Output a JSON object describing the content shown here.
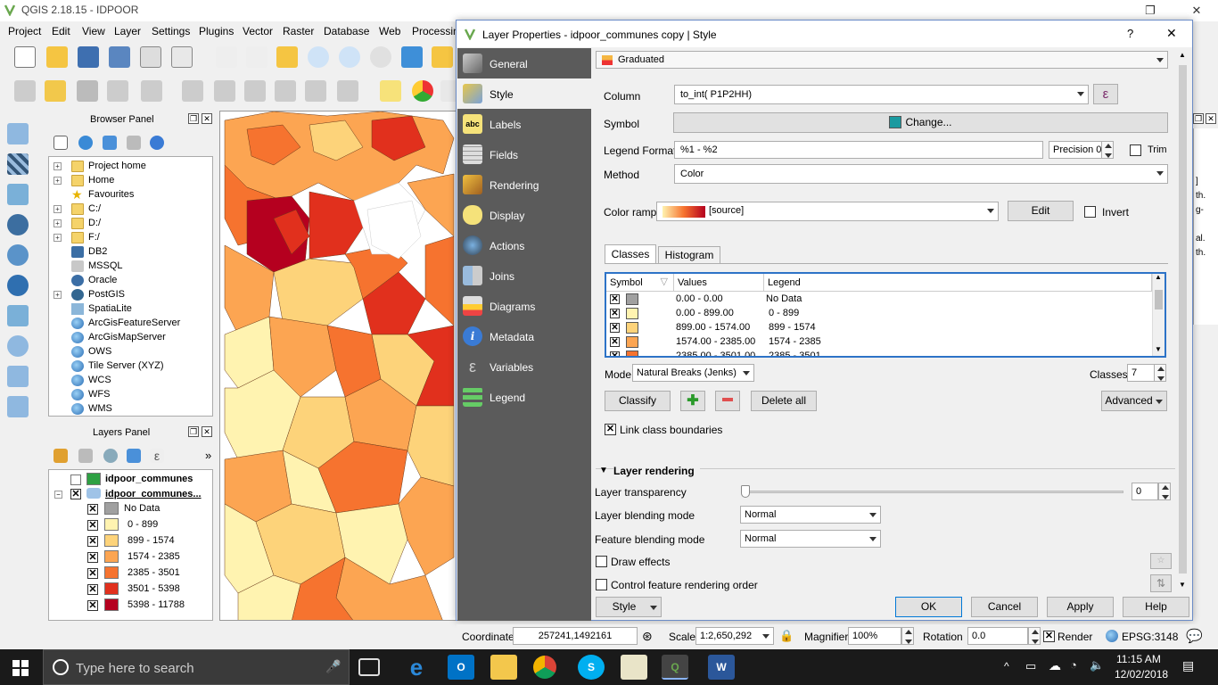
{
  "app": {
    "title": "QGIS 2.18.15 - IDPOOR"
  },
  "menu": [
    "Project",
    "Edit",
    "View",
    "Layer",
    "Settings",
    "Plugins",
    "Vector",
    "Raster",
    "Database",
    "Web",
    "Processing"
  ],
  "browser_panel": {
    "title": "Browser Panel",
    "items": [
      {
        "label": "Project home",
        "icon": "folder-icon",
        "expandable": true
      },
      {
        "label": "Home",
        "icon": "folder-icon",
        "expandable": true
      },
      {
        "label": "Favourites",
        "icon": "star-icon",
        "expandable": false
      },
      {
        "label": "C:/",
        "icon": "folder-icon",
        "expandable": true
      },
      {
        "label": "D:/",
        "icon": "folder-icon",
        "expandable": true
      },
      {
        "label": "F:/",
        "icon": "folder-icon",
        "expandable": true
      },
      {
        "label": "DB2",
        "icon": "db2-icon",
        "expandable": false
      },
      {
        "label": "MSSQL",
        "icon": "database-icon",
        "expandable": false
      },
      {
        "label": "Oracle",
        "icon": "database-icon",
        "expandable": false
      },
      {
        "label": "PostGIS",
        "icon": "elephant-icon",
        "expandable": true
      },
      {
        "label": "SpatiaLite",
        "icon": "feather-icon",
        "expandable": false
      },
      {
        "label": "ArcGisFeatureServer",
        "icon": "globe-icon",
        "expandable": false
      },
      {
        "label": "ArcGisMapServer",
        "icon": "globe-icon",
        "expandable": false
      },
      {
        "label": "OWS",
        "icon": "globe-icon",
        "expandable": false
      },
      {
        "label": "Tile Server (XYZ)",
        "icon": "globe-icon",
        "expandable": false
      },
      {
        "label": "WCS",
        "icon": "globe-icon",
        "expandable": false
      },
      {
        "label": "WFS",
        "icon": "globe-icon",
        "expandable": false
      },
      {
        "label": "WMS",
        "icon": "globe-icon",
        "expandable": false
      }
    ]
  },
  "layers_panel": {
    "title": "Layers Panel",
    "layers": [
      {
        "name": "idpoor_communes",
        "checked": false,
        "color": "#2ea043"
      },
      {
        "name": "idpoor_communes...",
        "checked": true
      }
    ],
    "legend": [
      {
        "label": "No Data",
        "color": "#a0a0a0"
      },
      {
        "label": "0 - 899",
        "color": "#fff3b0"
      },
      {
        "label": "899 - 1574",
        "color": "#fdd37a"
      },
      {
        "label": "1574 - 2385",
        "color": "#fca552"
      },
      {
        "label": "2385 - 3501",
        "color": "#f6732f"
      },
      {
        "label": "3501 - 5398",
        "color": "#e1301d"
      },
      {
        "label": "5398 - 11788",
        "color": "#b5001f"
      }
    ]
  },
  "dialog": {
    "title": "Layer Properties - idpoor_communes copy | Style",
    "help": "?",
    "close": "✕",
    "sidebar": [
      {
        "label": "General",
        "icon": "tools-icon"
      },
      {
        "label": "Style",
        "icon": "paintbrush-icon",
        "active": true
      },
      {
        "label": "Labels",
        "icon": "abc-icon"
      },
      {
        "label": "Fields",
        "icon": "table-icon"
      },
      {
        "label": "Rendering",
        "icon": "brush-icon"
      },
      {
        "label": "Display",
        "icon": "speech-bubble-icon"
      },
      {
        "label": "Actions",
        "icon": "gear-play-icon"
      },
      {
        "label": "Joins",
        "icon": "join-icon"
      },
      {
        "label": "Diagrams",
        "icon": "diagram-icon"
      },
      {
        "label": "Metadata",
        "icon": "info-icon"
      },
      {
        "label": "Variables",
        "icon": "epsilon-icon"
      },
      {
        "label": "Legend",
        "icon": "legend-icon"
      }
    ],
    "renderer": "Graduated",
    "column_label": "Column",
    "column_value": "to_int( P1P2HH)",
    "symbol_label": "Symbol",
    "symbol_button": "Change...",
    "symbol_color": "#1a9aa0",
    "legend_format_label": "Legend Format",
    "legend_format_value": "%1 - %2",
    "precision_label": "Precision 0",
    "trim_label": "Trim",
    "method_label": "Method",
    "method_value": "Color",
    "color_ramp_label": "Color ramp",
    "color_ramp_value": "[source]",
    "edit_button": "Edit",
    "invert_label": "Invert",
    "tabs": [
      "Classes",
      "Histogram"
    ],
    "table_headers": [
      "Symbol",
      "Values",
      "Legend"
    ],
    "classes": [
      {
        "values": "0.00 - 0.00",
        "legend": "No Data",
        "color": "#a0a0a0"
      },
      {
        "values": "0.00 - 899.00",
        "legend": "0 - 899",
        "color": "#fff3b0"
      },
      {
        "values": "899.00 - 1574.00",
        "legend": "899 - 1574",
        "color": "#fdd37a"
      },
      {
        "values": "1574.00 - 2385.00",
        "legend": "1574 - 2385",
        "color": "#fca552"
      },
      {
        "values": "2385.00 - 3501.00",
        "legend": "2385 - 3501",
        "color": "#f6732f"
      }
    ],
    "mode_label": "Mode",
    "mode_value": "Natural Breaks (Jenks)",
    "classes_label": "Classes",
    "classes_count": "7",
    "classify_button": "Classify",
    "delete_all_button": "Delete all",
    "advanced_button": "Advanced",
    "link_boundaries_label": "Link class boundaries",
    "layer_rendering_title": "Layer rendering",
    "transparency_label": "Layer transparency",
    "transparency_value": "0",
    "layer_blending_label": "Layer blending mode",
    "layer_blending_value": "Normal",
    "feature_blending_label": "Feature blending mode",
    "feature_blending_value": "Normal",
    "draw_effects_label": "Draw effects",
    "control_order_label": "Control feature rendering order",
    "style_button": "Style",
    "ok_button": "OK",
    "cancel_button": "Cancel",
    "apply_button": "Apply",
    "help_button": "Help"
  },
  "statusbar": {
    "coordinate_label": "Coordinate",
    "coordinate_value": "257241,1492161",
    "scale_label": "Scale",
    "scale_value": "1:2,650,292",
    "magnifier_label": "Magnifier",
    "magnifier_value": "100%",
    "rotation_label": "Rotation",
    "rotation_value": "0.0",
    "render_label": "Render",
    "epsg": "EPSG:3148"
  },
  "right_edge_text": [
    "]",
    "th.",
    "g-",
    "al.",
    "th."
  ],
  "taskbar": {
    "search_placeholder": "Type here to search",
    "time": "11:15 AM",
    "date": "12/02/2018"
  }
}
